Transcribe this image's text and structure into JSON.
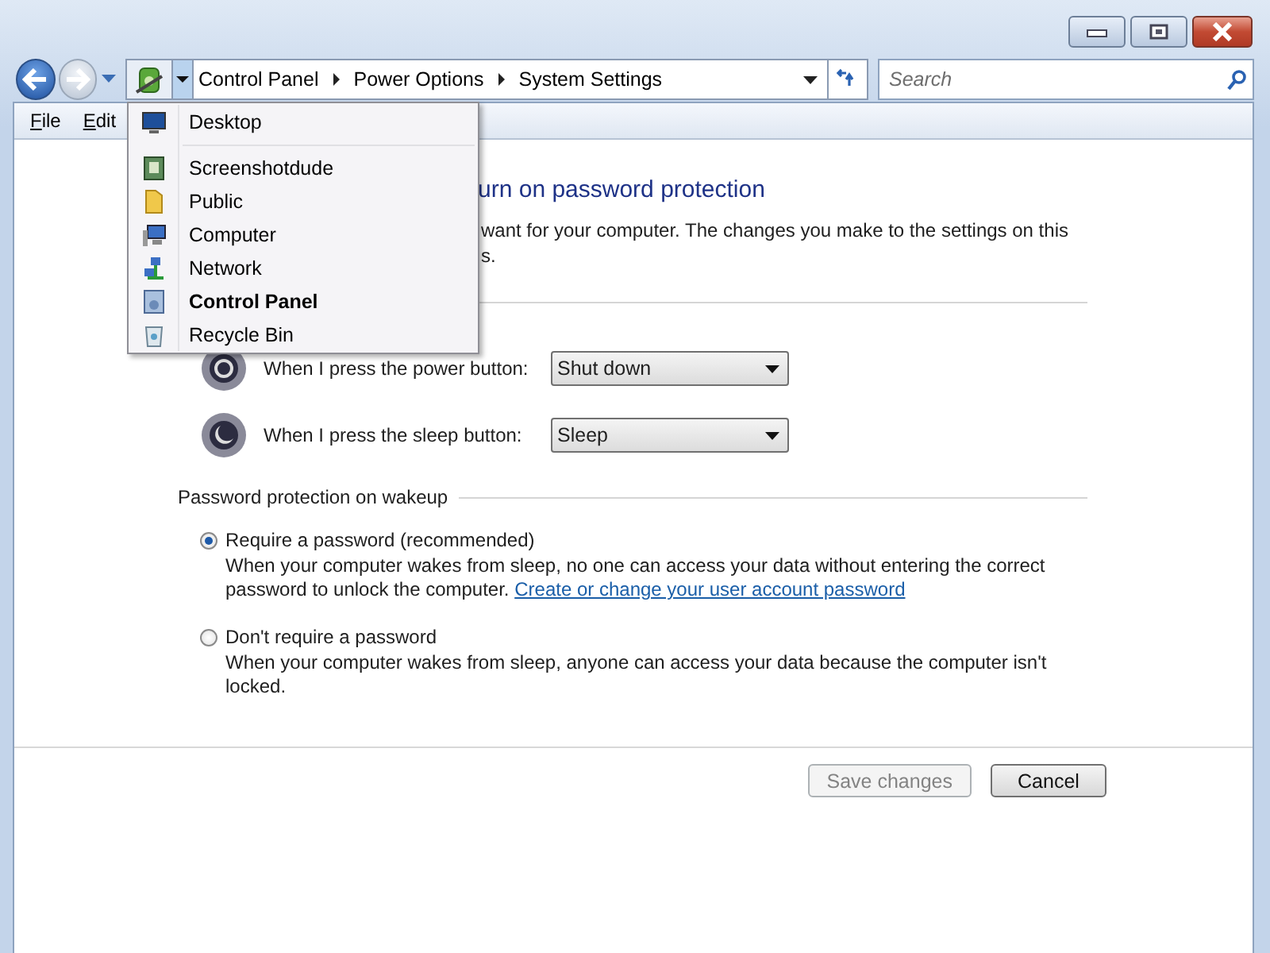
{
  "address_bar": {
    "breadcrumbs": [
      "Control Panel",
      "Power Options",
      "System Settings"
    ]
  },
  "search": {
    "placeholder": "Search"
  },
  "menu_bar": [
    "File",
    "Edit"
  ],
  "location_menu": {
    "sections": [
      [
        {
          "label": "Desktop",
          "kind": "desktop",
          "current": false
        }
      ],
      [
        {
          "label": "Screenshotdude",
          "kind": "user",
          "current": false
        },
        {
          "label": "Public",
          "kind": "folder",
          "current": false
        },
        {
          "label": "Computer",
          "kind": "computer",
          "current": false
        },
        {
          "label": "Network",
          "kind": "network",
          "current": false
        },
        {
          "label": "Control Panel",
          "kind": "panel",
          "current": true
        },
        {
          "label": "Recycle Bin",
          "kind": "bin",
          "current": false
        }
      ]
    ]
  },
  "page": {
    "heading": "urn on password protection",
    "description_lines": [
      "want for your computer. The changes you make to the settings on this",
      "s."
    ],
    "button_settings": [
      {
        "kind": "power",
        "label": "When I press the power button:",
        "value": "Shut down"
      },
      {
        "kind": "sleep",
        "label": "When I press the sleep button:",
        "value": "Sleep"
      }
    ],
    "password_section": {
      "title": "Password protection on wakeup",
      "options": [
        {
          "label": "Require a password (recommended)",
          "selected": true,
          "description": "When your computer wakes from sleep, no one can access your data without entering the correct password to unlock the computer.",
          "link": "Create or change your user account password"
        },
        {
          "label": "Don't require a password",
          "selected": false,
          "description": "When your computer wakes from sleep, anyone can access your data because the computer isn't locked."
        }
      ]
    },
    "actions": [
      {
        "label": "Save changes",
        "disabled": true
      },
      {
        "label": "Cancel",
        "disabled": false
      }
    ]
  }
}
